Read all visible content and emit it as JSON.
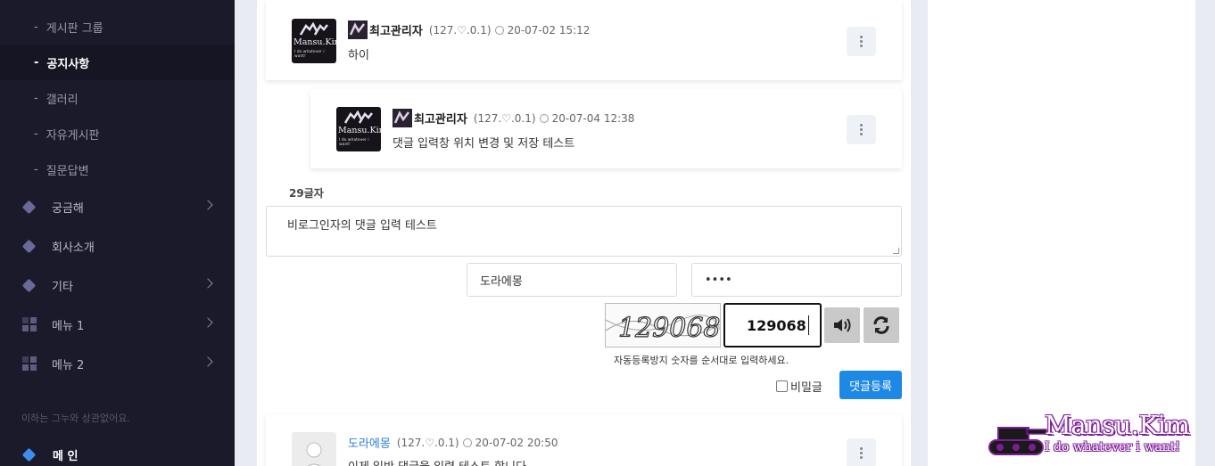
{
  "sidebar": {
    "sub_items": [
      {
        "label": "게시판 그룹"
      },
      {
        "label": "공지사항"
      },
      {
        "label": "갤러리"
      },
      {
        "label": "자유게시판"
      },
      {
        "label": "질문답변"
      }
    ],
    "nav_items": [
      {
        "label": "궁금해",
        "icon": "diamond-icon"
      },
      {
        "label": "회사소개",
        "icon": "diamond-icon"
      },
      {
        "label": "기타",
        "icon": "diamond-icon"
      },
      {
        "label": "메뉴 1",
        "icon": "grid-icon"
      },
      {
        "label": "메뉴 2",
        "icon": "grid-icon"
      }
    ],
    "note": "이하는 그누와 상관없어요.",
    "main_label": "메 인"
  },
  "avatar_logo": {
    "title": "Mansu.Kim",
    "sub": "I do whatever i want!"
  },
  "comments": [
    {
      "name": "최고관리자",
      "ip": "(127.♡.0.1)",
      "date": "20-07-02 15:12",
      "body": "하이"
    },
    {
      "name": "최고관리자",
      "ip": "(127.♡.0.1)",
      "date": "20-07-04 12:38",
      "body": "댓글 입력창 위치 변경 및 저장 테스트"
    },
    {
      "name": "도라에몽",
      "ip": "(127.♡.0.1)",
      "date": "20-07-02 20:50",
      "body": "이제 일반 댓글을 입력 테스트 합니다"
    }
  ],
  "form": {
    "char_count": "29글자",
    "comment_text": "비로그인자의 댓글 입력 테스트",
    "name_value": "도라에몽",
    "password_value": "••••",
    "captcha_image_text": "129068",
    "captcha_value": "129068",
    "captcha_help": "자동등록방지 숫자를 순서대로 입력하세요.",
    "secret_label": "비밀글",
    "submit_label": "댓글등록"
  },
  "brand": {
    "title": "Mansu.Kim",
    "subtitle": "I do whatever i want!"
  },
  "colors": {
    "accent": "#1e88e5",
    "sidebar_bg": "#1b1a2b",
    "brand_outline": "#7d1c99"
  }
}
